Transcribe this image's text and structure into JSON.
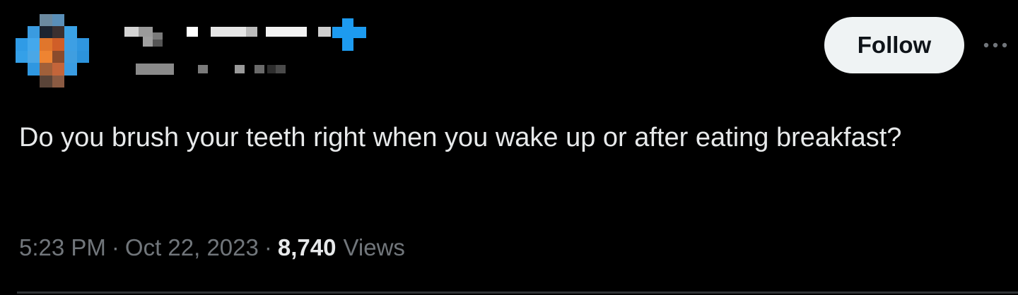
{
  "tweet": {
    "text": "Do you brush your teeth right when you wake up or after eating breakfast?",
    "time": "5:23 PM",
    "separator": "·",
    "date": "Oct 22, 2023",
    "views_count": "8,740",
    "views_label": "Views"
  },
  "actions": {
    "follow_label": "Follow",
    "more_icon": "more-horizontal-icon"
  },
  "author": {
    "avatar_icon": "pixelated-avatar",
    "name_censored": true
  },
  "colors": {
    "background": "#000000",
    "text": "#e7e9ea",
    "muted": "#71767b",
    "follow_bg": "#eff3f4",
    "follow_text": "#0f1419",
    "verified_blue": "#1d9bf0"
  }
}
